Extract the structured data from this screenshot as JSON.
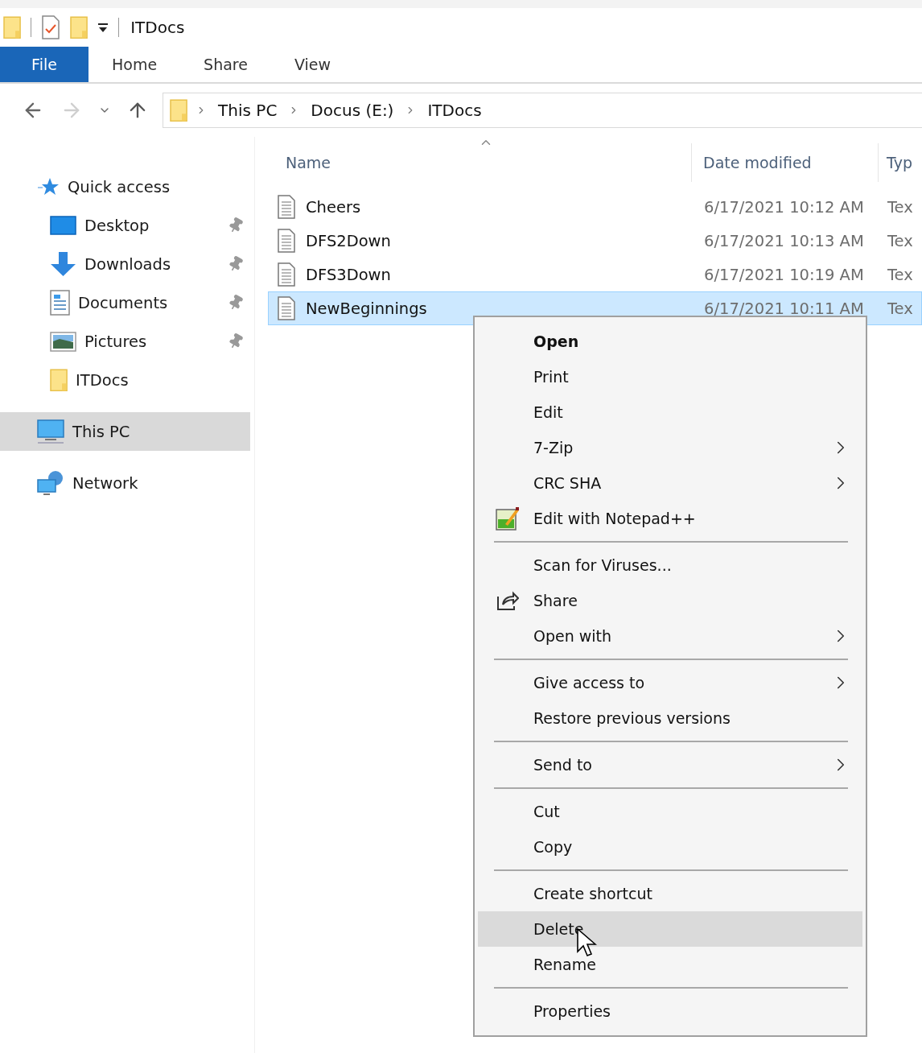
{
  "window": {
    "title": "ITDocs"
  },
  "ribbon_tabs": [
    {
      "label": "File",
      "selected": true
    },
    {
      "label": "Home",
      "selected": false
    },
    {
      "label": "Share",
      "selected": false
    },
    {
      "label": "View",
      "selected": false
    }
  ],
  "address_bar": {
    "segments": [
      "This PC",
      "Docus (E:)",
      "ITDocs"
    ]
  },
  "navigation": [
    {
      "label": "Quick access",
      "kind": "star",
      "selected": false,
      "children": [
        {
          "label": "Desktop",
          "kind": "desktop",
          "pinned": true,
          "selected": false
        },
        {
          "label": "Downloads",
          "kind": "downloads",
          "pinned": true,
          "selected": false
        },
        {
          "label": "Documents",
          "kind": "documents",
          "pinned": true,
          "selected": false
        },
        {
          "label": "Pictures",
          "kind": "pictures",
          "pinned": true,
          "selected": false
        },
        {
          "label": "ITDocs",
          "kind": "folder",
          "pinned": false,
          "selected": false
        }
      ]
    },
    {
      "label": "This PC",
      "kind": "computer",
      "selected": true
    },
    {
      "label": "Network",
      "kind": "network",
      "selected": false
    }
  ],
  "columns": [
    {
      "label": "Name",
      "sorted": true
    },
    {
      "label": "Date modified",
      "sorted": false
    },
    {
      "label": "Typ",
      "sorted": false
    }
  ],
  "files": [
    {
      "name": "Cheers",
      "date_modified": "6/17/2021 10:12 AM",
      "type": "Tex",
      "selected": false
    },
    {
      "name": "DFS2Down",
      "date_modified": "6/17/2021 10:13 AM",
      "type": "Tex",
      "selected": false
    },
    {
      "name": "DFS3Down",
      "date_modified": "6/17/2021 10:19 AM",
      "type": "Tex",
      "selected": false
    },
    {
      "name": "NewBeginnings",
      "date_modified": "6/17/2021 10:11 AM",
      "type": "Tex",
      "selected": true
    }
  ],
  "context_menu": {
    "groups": [
      {
        "items": [
          {
            "label": "Open",
            "kind": "plain",
            "default": true,
            "submenu": false,
            "selected": false
          },
          {
            "label": "Print",
            "kind": "plain",
            "default": false,
            "submenu": false,
            "selected": false
          },
          {
            "label": "Edit",
            "kind": "plain",
            "default": false,
            "submenu": false,
            "selected": false
          },
          {
            "label": "7-Zip",
            "kind": "plain",
            "default": false,
            "submenu": true,
            "selected": false
          },
          {
            "label": "CRC SHA",
            "kind": "plain",
            "default": false,
            "submenu": true,
            "selected": false
          },
          {
            "label": "Edit with Notepad++",
            "kind": "notepad",
            "default": false,
            "submenu": false,
            "selected": false
          }
        ]
      },
      {
        "items": [
          {
            "label": "Scan for Viruses...",
            "kind": "plain",
            "default": false,
            "submenu": false,
            "selected": false
          },
          {
            "label": "Share",
            "kind": "share",
            "default": false,
            "submenu": false,
            "selected": false
          },
          {
            "label": "Open with",
            "kind": "plain",
            "default": false,
            "submenu": true,
            "selected": false
          }
        ]
      },
      {
        "items": [
          {
            "label": "Give access to",
            "kind": "plain",
            "default": false,
            "submenu": true,
            "selected": false
          },
          {
            "label": "Restore previous versions",
            "kind": "plain",
            "default": false,
            "submenu": false,
            "selected": false
          }
        ]
      },
      {
        "items": [
          {
            "label": "Send to",
            "kind": "plain",
            "default": false,
            "submenu": true,
            "selected": false
          }
        ]
      },
      {
        "items": [
          {
            "label": "Cut",
            "kind": "plain",
            "default": false,
            "submenu": false,
            "selected": false
          },
          {
            "label": "Copy",
            "kind": "plain",
            "default": false,
            "submenu": false,
            "selected": false
          }
        ]
      },
      {
        "items": [
          {
            "label": "Create shortcut",
            "kind": "plain",
            "default": false,
            "submenu": false,
            "selected": false
          },
          {
            "label": "Delete",
            "kind": "plain",
            "default": false,
            "submenu": false,
            "selected": true
          },
          {
            "label": "Rename",
            "kind": "plain",
            "default": false,
            "submenu": false,
            "selected": false
          }
        ]
      },
      {
        "items": [
          {
            "label": "Properties",
            "kind": "plain",
            "default": false,
            "submenu": false,
            "selected": false
          }
        ]
      }
    ]
  }
}
